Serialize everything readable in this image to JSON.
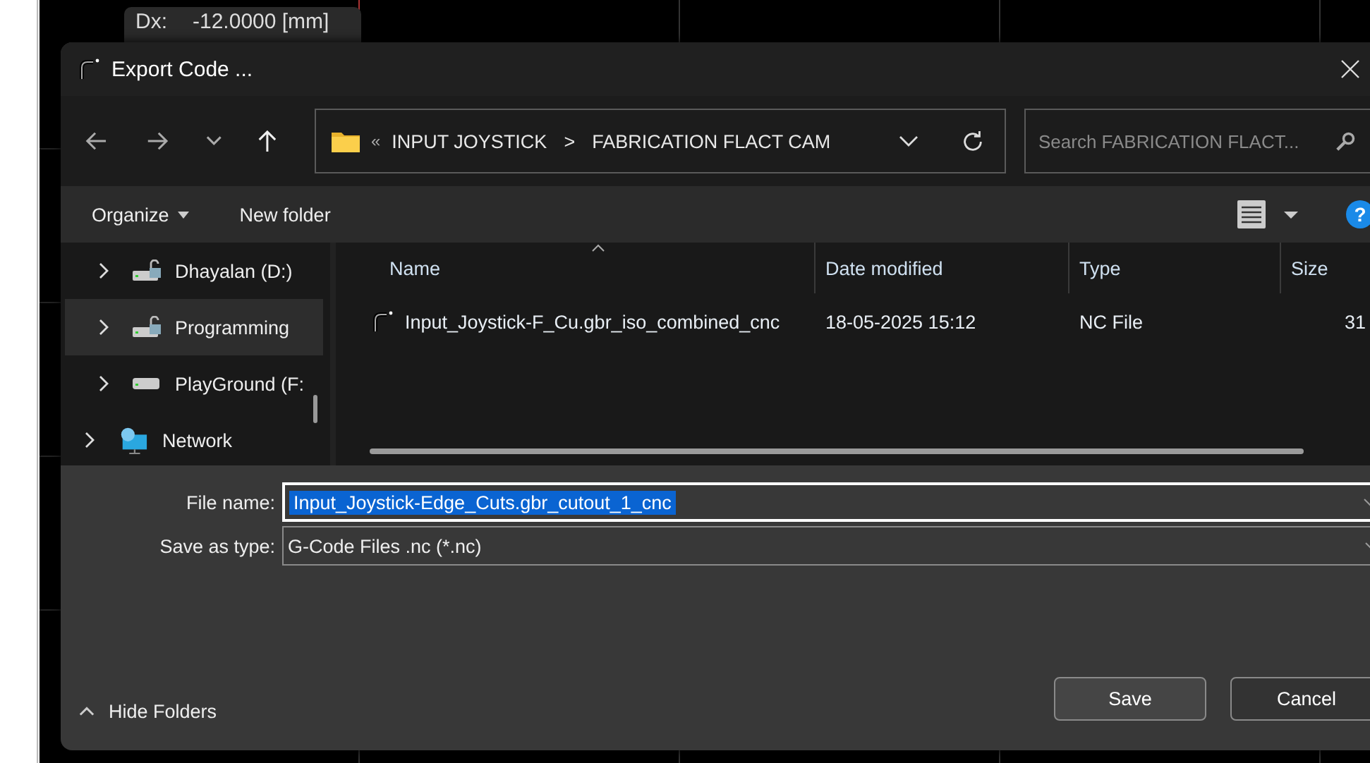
{
  "canvas": {
    "tooltip": {
      "label": "Dx:",
      "value": "-12.0000 [mm]"
    }
  },
  "window": {
    "title": "Export Code ..."
  },
  "address_bar": {
    "overflow": "«",
    "crumbs": [
      "INPUT JOYSTICK",
      "FABRICATION FLACT CAM"
    ],
    "separator": ">"
  },
  "search": {
    "placeholder": "Search FABRICATION FLACT..."
  },
  "toolbar": {
    "organize": "Organize",
    "new_folder": "New folder",
    "help": "?"
  },
  "sidebar": {
    "items": [
      {
        "label": "Dhayalan (D:)",
        "kind": "locked-drive",
        "selected": false
      },
      {
        "label": "Programming",
        "kind": "locked-drive",
        "selected": true
      },
      {
        "label": "PlayGround (F:",
        "kind": "drive",
        "selected": false
      },
      {
        "label": "Network",
        "kind": "network",
        "selected": false
      }
    ]
  },
  "table": {
    "columns": [
      "Name",
      "Date modified",
      "Type",
      "Size"
    ],
    "rows": [
      {
        "cells": [
          "Input_Joystick-F_Cu.gbr_iso_combined_cnc",
          "18-05-2025 15:12",
          "NC File",
          "31"
        ]
      }
    ]
  },
  "form": {
    "file_name_label": "File name:",
    "file_name": "Input_Joystick-Edge_Cuts.gbr_cutout_1_cnc",
    "type_label": "Save as type:",
    "type_value": "G-Code Files .nc (*.nc)"
  },
  "footer": {
    "hide_folders": "Hide Folders",
    "save": "Save",
    "cancel": "Cancel"
  }
}
